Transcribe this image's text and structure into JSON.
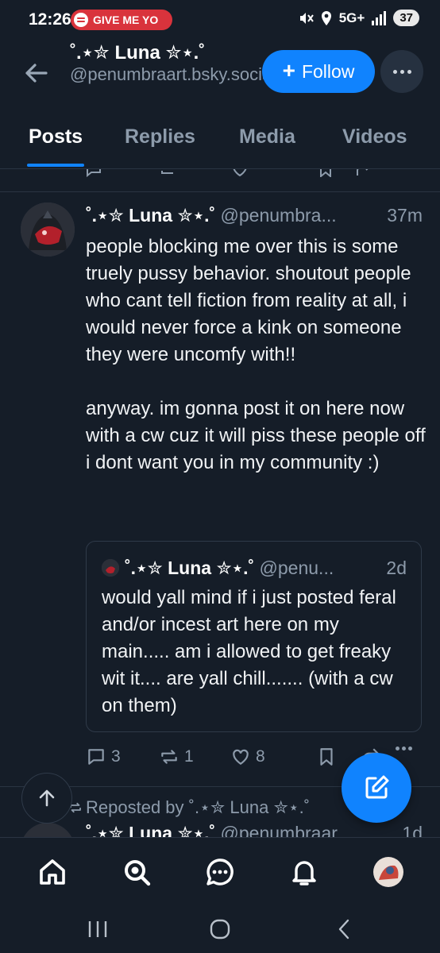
{
  "status_bar": {
    "time": "12:26",
    "media_pill": "GIVE ME YO",
    "network": "5G+",
    "battery": "37"
  },
  "header": {
    "display_name": "˚.⋆✮ Luna ✮⋆.˚",
    "handle": "@penumbraart.bsky.social",
    "follow_label": "Follow"
  },
  "tabs": [
    "Posts",
    "Replies",
    "Media",
    "Videos"
  ],
  "post": {
    "display_name": "˚.⋆✮ Luna ✮⋆.˚",
    "handle": "@penumbra...",
    "time": "37m",
    "paragraph_1": "people blocking me over this is some truely pussy behavior. shoutout people who cant tell fiction from reality at all, i would never force a kink on someone they were uncomfy with!!",
    "paragraph_2": "anyway. im gonna post it on here now with a cw cuz it will piss these people off i dont want you in my community :)",
    "quote": {
      "display_name": "˚.⋆✮ Luna ✮⋆.˚",
      "handle": "@penu...",
      "time": "2d",
      "text": "would yall mind if i just posted feral and/or incest art here on my main..... am i allowed to get freaky wit it.... are yall chill....... (with a cw on them)"
    },
    "replies": "3",
    "reposts": "1",
    "likes": "8"
  },
  "repost_row": {
    "label": "Reposted by ˚.⋆✮ Luna ✮⋆.˚",
    "next_name": "˚.⋆✮ Luna ✮⋆.˚",
    "next_handle": "@penumbraar...",
    "next_time": "1d"
  },
  "colors": {
    "background": "#151d28",
    "accent": "#1083fe",
    "muted_text": "#8d9bab",
    "status_pill": "#d9333c"
  },
  "icons": {
    "back": "arrow-left-icon",
    "more": "ellipsis-icon",
    "reply": "speech-bubble-icon",
    "repost": "repost-arrows-icon",
    "like": "heart-icon",
    "bookmark": "bookmark-icon",
    "share": "share-arrow-icon",
    "compose": "compose-icon",
    "scroll_top": "arrow-up-icon",
    "nav": [
      "home-icon",
      "search-icon",
      "chat-icon",
      "bell-icon",
      "avatar"
    ],
    "system": [
      "recents-icon",
      "home-circle-icon",
      "back-chevron-icon"
    ]
  }
}
